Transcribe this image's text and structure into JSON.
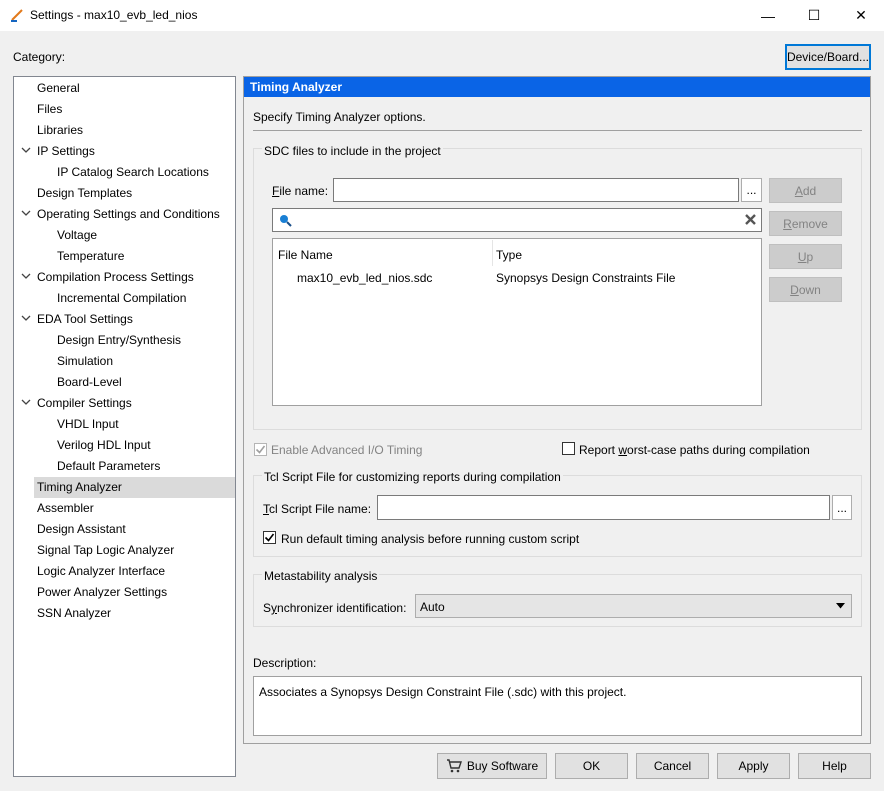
{
  "window": {
    "title": "Settings - max10_evb_led_nios",
    "minimize_glyph": "—",
    "maximize_glyph": "☐",
    "close_glyph": "✕"
  },
  "category_label": "Category:",
  "device_board_button": "Device/Board...",
  "tree": [
    {
      "label": "General",
      "level": 0
    },
    {
      "label": "Files",
      "level": 0
    },
    {
      "label": "Libraries",
      "level": 0
    },
    {
      "label": "IP Settings",
      "level": 0,
      "expanded": true
    },
    {
      "label": "IP Catalog Search Locations",
      "level": 1
    },
    {
      "label": "Design Templates",
      "level": 0
    },
    {
      "label": "Operating Settings and Conditions",
      "level": 0,
      "expanded": true
    },
    {
      "label": "Voltage",
      "level": 1
    },
    {
      "label": "Temperature",
      "level": 1
    },
    {
      "label": "Compilation Process Settings",
      "level": 0,
      "expanded": true
    },
    {
      "label": "Incremental Compilation",
      "level": 1
    },
    {
      "label": "EDA Tool Settings",
      "level": 0,
      "expanded": true
    },
    {
      "label": "Design Entry/Synthesis",
      "level": 1
    },
    {
      "label": "Simulation",
      "level": 1
    },
    {
      "label": "Board-Level",
      "level": 1
    },
    {
      "label": "Compiler Settings",
      "level": 0,
      "expanded": true
    },
    {
      "label": "VHDL Input",
      "level": 1
    },
    {
      "label": "Verilog HDL Input",
      "level": 1
    },
    {
      "label": "Default Parameters",
      "level": 1
    },
    {
      "label": "Timing Analyzer",
      "level": 0,
      "selected": true
    },
    {
      "label": "Assembler",
      "level": 0
    },
    {
      "label": "Design Assistant",
      "level": 0
    },
    {
      "label": "Signal Tap Logic Analyzer",
      "level": 0
    },
    {
      "label": "Logic Analyzer Interface",
      "level": 0
    },
    {
      "label": "Power Analyzer Settings",
      "level": 0
    },
    {
      "label": "SSN Analyzer",
      "level": 0
    }
  ],
  "panel": {
    "header": "Timing Analyzer",
    "intro": "Specify Timing Analyzer options.",
    "sdc_group": {
      "title": "SDC files to include in the project",
      "file_name_label_u": "F",
      "file_name_label_rest": "ile name:",
      "file_name_value": "",
      "browse_label": "...",
      "search_value": "",
      "buttons": {
        "add_u": "A",
        "add_rest": "dd",
        "remove_u": "R",
        "remove_rest": "emove",
        "up_u": "U",
        "up_rest": "p",
        "down_u": "D",
        "down_rest": "own"
      },
      "columns": [
        "File Name",
        "Type"
      ],
      "rows": [
        {
          "file": "max10_evb_led_nios.sdc",
          "type": "Synopsys Design Constraints File"
        }
      ]
    },
    "enable_advanced_io": {
      "label": "Enable Advanced I/O Timing",
      "checked": true,
      "disabled": true
    },
    "report_worst_case": {
      "label_pre": "Report ",
      "label_u": "w",
      "label_post": "orst-case paths during compilation",
      "checked": false
    },
    "tcl_group": {
      "title": "Tcl Script File for customizing reports during compilation",
      "file_label_u": "T",
      "file_label_rest": "cl Script File name:",
      "file_value": "",
      "browse_label": "...",
      "run_default": {
        "label": "Run default timing analysis before running custom script",
        "checked": true
      }
    },
    "meta_group": {
      "title": "Metastability analysis",
      "sync_label_pre": "S",
      "sync_label_u": "y",
      "sync_label_post": "nchronizer identification:",
      "sync_value": "Auto"
    },
    "description_label": "Description:",
    "description_text": "Associates a Synopsys Design Constraint File (.sdc) with this project."
  },
  "footer": {
    "buy_software": "Buy Software",
    "ok": "OK",
    "cancel": "Cancel",
    "apply": "Apply",
    "help": "Help"
  }
}
